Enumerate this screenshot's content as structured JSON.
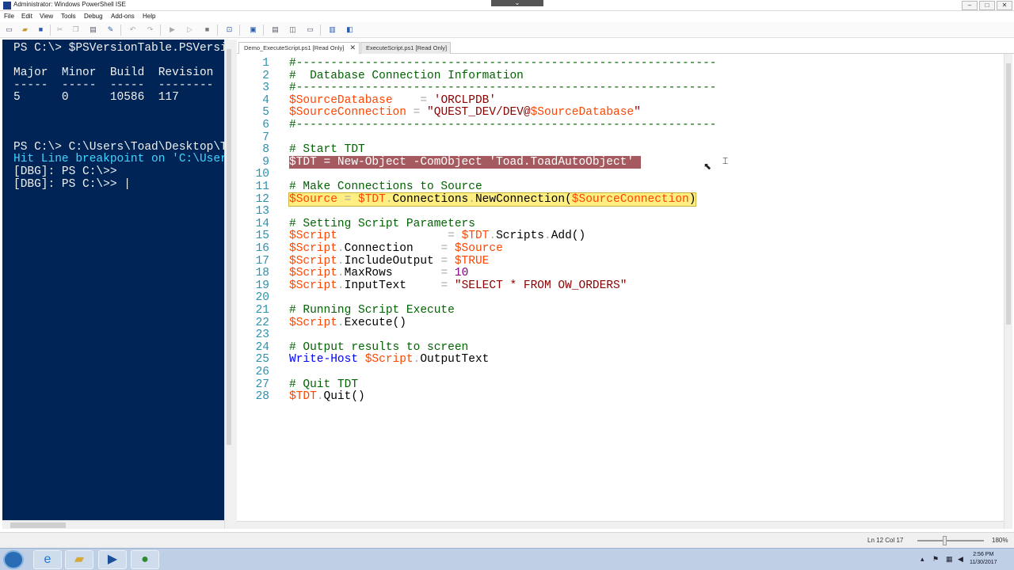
{
  "window": {
    "title": "Administrator: Windows PowerShell ISE",
    "collapse_tab": "⌄",
    "minimize": "–",
    "maximize": "□",
    "close": "✕"
  },
  "menu": [
    "File",
    "Edit",
    "View",
    "Tools",
    "Debug",
    "Add-ons",
    "Help"
  ],
  "toolbar_icons": [
    "new-icon",
    "open-icon",
    "save-icon",
    "cut-icon",
    "copy-icon",
    "paste-icon",
    "clear-icon",
    "undo-icon",
    "redo-icon",
    "run-icon",
    "run-selection-icon",
    "stop-icon",
    "remote-icon",
    "powershell-icon",
    "layout-top-icon",
    "layout-right-icon",
    "layout-max-icon",
    "script-pane-icon",
    "commands-icon"
  ],
  "console": {
    "lines": [
      {
        "text": "PS C:\\> $PSVersionTable.PSVersion",
        "style": "white"
      },
      {
        "text": "",
        "style": "white"
      },
      {
        "text": "Major  Minor  Build  Revision",
        "style": "white"
      },
      {
        "text": "-----  -----  -----  --------",
        "style": "white"
      },
      {
        "text": "5      0      10586  117",
        "style": "white"
      },
      {
        "text": "",
        "style": "white"
      },
      {
        "text": "",
        "style": "white"
      },
      {
        "text": "",
        "style": "white"
      },
      {
        "text": "PS C:\\> C:\\Users\\Toad\\Desktop\\T",
        "style": "white"
      },
      {
        "text": "Hit Line breakpoint on 'C:\\User",
        "style": "cyan"
      },
      {
        "text": "[DBG]: PS C:\\>>",
        "style": "white"
      },
      {
        "text": "[DBG]: PS C:\\>> |",
        "style": "white"
      }
    ]
  },
  "tabs": [
    {
      "label": "Demo_ExecuteScript.ps1 [Read Only]",
      "active": true,
      "close": "✕"
    },
    {
      "label": "ExecuteScript.ps1 [Read Only]",
      "active": false
    }
  ],
  "code": [
    {
      "n": "1",
      "tokens": [
        [
          "#-------------------------------------------------------------",
          "comment"
        ]
      ]
    },
    {
      "n": "2",
      "tokens": [
        [
          "#  Database Connection Information",
          "comment"
        ]
      ]
    },
    {
      "n": "3",
      "tokens": [
        [
          "#-------------------------------------------------------------",
          "comment"
        ]
      ]
    },
    {
      "n": "4",
      "tokens": [
        [
          "$SourceDatabase",
          "var"
        ],
        [
          "    ",
          "mem"
        ],
        [
          "=",
          "op"
        ],
        [
          " ",
          "mem"
        ],
        [
          "'ORCLPDB'",
          "str"
        ]
      ]
    },
    {
      "n": "5",
      "tokens": [
        [
          "$SourceConnection",
          "var"
        ],
        [
          " ",
          "mem"
        ],
        [
          "=",
          "op"
        ],
        [
          " ",
          "mem"
        ],
        [
          "\"QUEST_DEV/DEV@",
          "str"
        ],
        [
          "$SourceDatabase",
          "var"
        ],
        [
          "\"",
          "str"
        ]
      ]
    },
    {
      "n": "6",
      "tokens": [
        [
          "#-------------------------------------------------------------",
          "comment"
        ]
      ]
    },
    {
      "n": "7",
      "tokens": []
    },
    {
      "n": "8",
      "tokens": [
        [
          "# Start TDT",
          "comment"
        ]
      ]
    },
    {
      "n": "9",
      "tokens": [
        [
          "$TDT = New-Object -ComObject 'Toad.ToadAutoObject' ",
          "mem"
        ]
      ],
      "line_style": "bp"
    },
    {
      "n": "10",
      "tokens": []
    },
    {
      "n": "11",
      "tokens": [
        [
          "# Make Connections to Source",
          "comment"
        ]
      ]
    },
    {
      "n": "12",
      "tokens": [
        [
          "$Source",
          "var"
        ],
        [
          " ",
          "mem"
        ],
        [
          "=",
          "op"
        ],
        [
          " ",
          "mem"
        ],
        [
          "$TDT",
          "var"
        ],
        [
          ".",
          "op"
        ],
        [
          "Connections",
          "mem"
        ],
        [
          ".",
          "op"
        ],
        [
          "NewConnection(",
          "mem"
        ],
        [
          "$SourceConnection",
          "var"
        ],
        [
          ")",
          "mem"
        ]
      ],
      "line_style": "current"
    },
    {
      "n": "13",
      "tokens": []
    },
    {
      "n": "14",
      "tokens": [
        [
          "# Setting Script Parameters",
          "comment"
        ]
      ]
    },
    {
      "n": "15",
      "tokens": [
        [
          "$Script",
          "var"
        ],
        [
          "                ",
          "mem"
        ],
        [
          "=",
          "op"
        ],
        [
          " ",
          "mem"
        ],
        [
          "$TDT",
          "var"
        ],
        [
          ".",
          "op"
        ],
        [
          "Scripts",
          "mem"
        ],
        [
          ".",
          "op"
        ],
        [
          "Add()",
          "mem"
        ]
      ]
    },
    {
      "n": "16",
      "tokens": [
        [
          "$Script",
          "var"
        ],
        [
          ".",
          "op"
        ],
        [
          "Connection",
          "mem"
        ],
        [
          "    ",
          "mem"
        ],
        [
          "=",
          "op"
        ],
        [
          " ",
          "mem"
        ],
        [
          "$Source",
          "var"
        ]
      ]
    },
    {
      "n": "17",
      "tokens": [
        [
          "$Script",
          "var"
        ],
        [
          ".",
          "op"
        ],
        [
          "IncludeOutput",
          "mem"
        ],
        [
          " ",
          "mem"
        ],
        [
          "=",
          "op"
        ],
        [
          " ",
          "mem"
        ],
        [
          "$TRUE",
          "var"
        ]
      ]
    },
    {
      "n": "18",
      "tokens": [
        [
          "$Script",
          "var"
        ],
        [
          ".",
          "op"
        ],
        [
          "MaxRows",
          "mem"
        ],
        [
          "       ",
          "mem"
        ],
        [
          "=",
          "op"
        ],
        [
          " ",
          "mem"
        ],
        [
          "10",
          "num"
        ]
      ]
    },
    {
      "n": "19",
      "tokens": [
        [
          "$Script",
          "var"
        ],
        [
          ".",
          "op"
        ],
        [
          "InputText",
          "mem"
        ],
        [
          "     ",
          "mem"
        ],
        [
          "=",
          "op"
        ],
        [
          " ",
          "mem"
        ],
        [
          "\"SELECT * FROM OW_ORDERS\"",
          "str"
        ]
      ]
    },
    {
      "n": "20",
      "tokens": []
    },
    {
      "n": "21",
      "tokens": [
        [
          "# Running Script Execute",
          "comment"
        ]
      ]
    },
    {
      "n": "22",
      "tokens": [
        [
          "$Script",
          "var"
        ],
        [
          ".",
          "op"
        ],
        [
          "Execute()",
          "mem"
        ]
      ]
    },
    {
      "n": "23",
      "tokens": []
    },
    {
      "n": "24",
      "tokens": [
        [
          "# Output results to screen",
          "comment"
        ]
      ]
    },
    {
      "n": "25",
      "tokens": [
        [
          "Write-Host",
          "cmd"
        ],
        [
          " ",
          "mem"
        ],
        [
          "$Script",
          "var"
        ],
        [
          ".",
          "op"
        ],
        [
          "OutputText",
          "mem"
        ]
      ]
    },
    {
      "n": "26",
      "tokens": []
    },
    {
      "n": "27",
      "tokens": [
        [
          "# Quit TDT",
          "comment"
        ]
      ]
    },
    {
      "n": "28",
      "tokens": [
        [
          "$TDT",
          "var"
        ],
        [
          ".",
          "op"
        ],
        [
          "Quit()",
          "mem"
        ]
      ]
    }
  ],
  "status": {
    "position": "Ln 12  Col 17",
    "zoom": "180%",
    "zoom_level_percent": 180
  },
  "taskbar": {
    "clock_time": "2:56 PM",
    "clock_date": "11/30/2017",
    "apps": [
      "internet-explorer-icon",
      "file-explorer-icon",
      "powershell-ise-icon",
      "toad-icon"
    ]
  },
  "colors": {
    "console_bg": "#012456",
    "breakpoint_line": "#a45a5f",
    "current_line": "#ffee82",
    "line_numbers": "#2b91af"
  }
}
